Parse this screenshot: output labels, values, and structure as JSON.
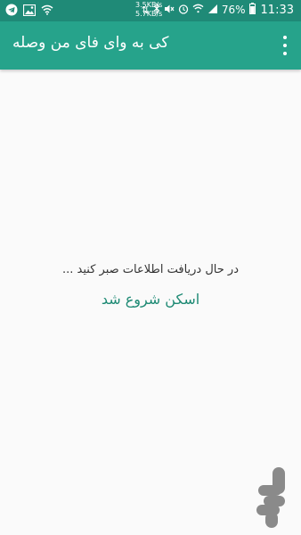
{
  "status_bar": {
    "speed_up": "3.5KB/s",
    "speed_down": "5.7KB/s",
    "battery": "76%",
    "time": "11:33",
    "left_icons": [
      "telegram-icon",
      "image-icon",
      "wifi-icon"
    ],
    "right_icons": [
      "data-arrows-icon",
      "bluetooth-icon",
      "mute-icon",
      "alarm-icon",
      "wifi-icon",
      "signal-icon",
      "battery-icon"
    ]
  },
  "app_bar": {
    "title": "کی به وای فای من وصله",
    "menu_icon": "more-vert-icon",
    "color": "#26a38b"
  },
  "content": {
    "status_message": "در حال دریافت اطلاعات صبر کنید ...",
    "scan_label": "اسکن شروع شد",
    "accent_color": "#1e8a74"
  },
  "watermark": {
    "icon": "store-logo-icon"
  }
}
